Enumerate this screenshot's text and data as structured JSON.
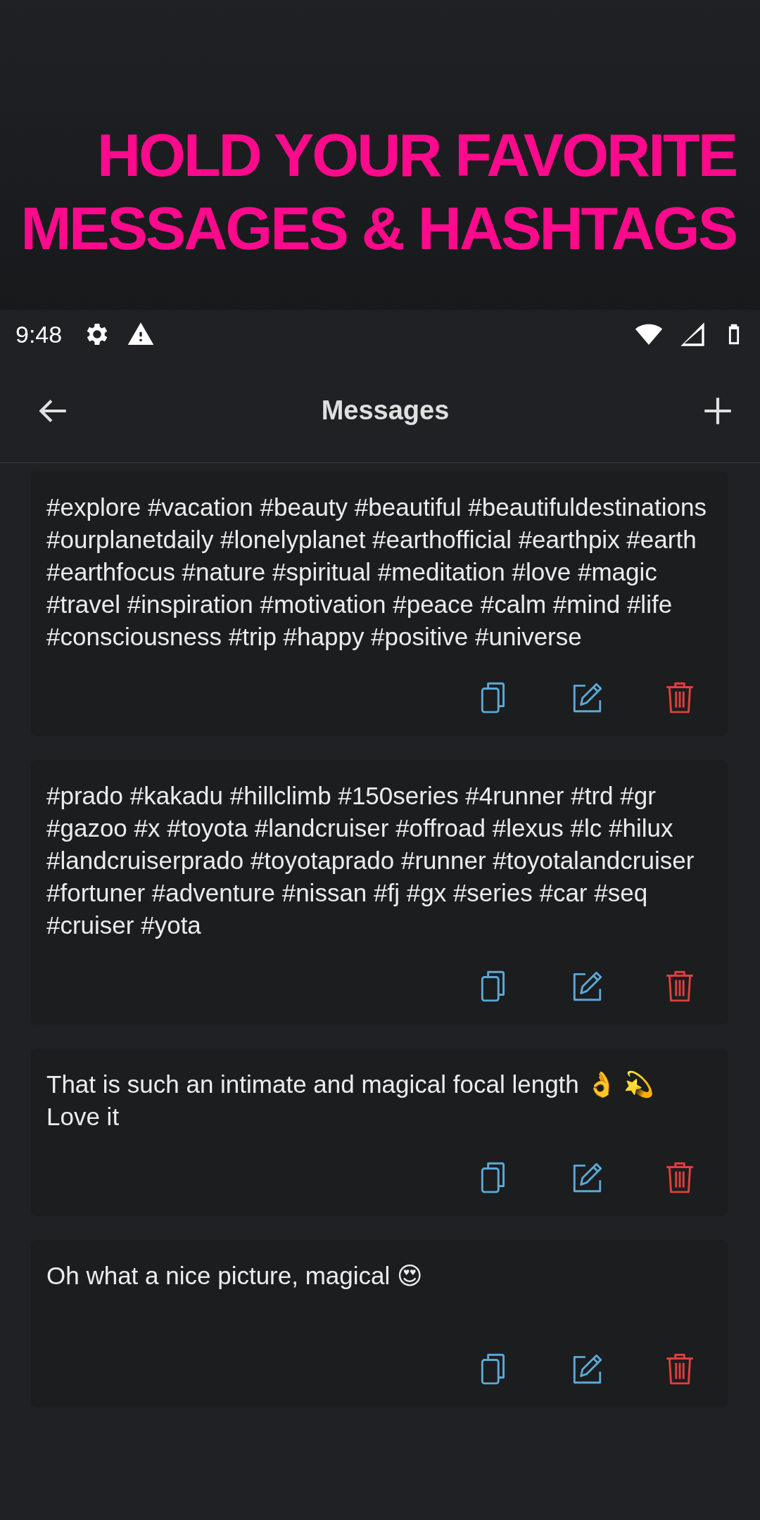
{
  "banner": {
    "lines": [
      "HOLD YOUR FAVORITE",
      "MESSAGES & HASHTAGS"
    ]
  },
  "status_bar": {
    "time": "9:48"
  },
  "toolbar": {
    "title": "Messages"
  },
  "messages": [
    {
      "text": "#explore #vacation #beauty #beautiful #beautifuldestinations #ourplanetdaily #lonelyplanet #earthofficial #earthpix #earth #earthfocus #nature #spiritual #meditation #love #magic #travel #inspiration #motivation #peace #calm #mind #life #consciousness #trip #happy #positive #universe"
    },
    {
      "text": "#prado #kakadu #hillclimb #150series #4runner #trd #gr #gazoo #x #toyota #landcruiser #offroad #lexus #lc #hilux #landcruiserprado #toyotaprado #runner #toyotalandcruiser #fortuner #adventure #nissan #fj #gx #series #car #seq #cruiser #yota"
    },
    {
      "text": "That is such an intimate and magical focal length 👌 💫 Love it"
    },
    {
      "text": "Oh what a nice picture, magical 😍"
    }
  ]
}
